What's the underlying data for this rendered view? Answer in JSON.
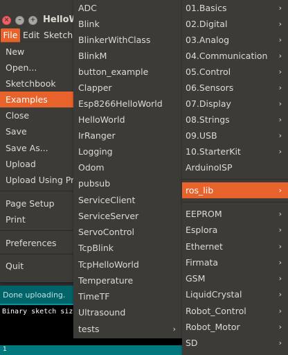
{
  "window": {
    "title": "HelloW",
    "close_glyph": "×",
    "min_glyph": "–",
    "max_glyph": "+"
  },
  "menubar": {
    "file": "File",
    "edit": "Edit",
    "sketch": "Sketch"
  },
  "file_menu": {
    "items": [
      "New",
      "Open...",
      "Sketchbook",
      "Examples",
      "Close",
      "Save",
      "Save As...",
      "Upload",
      "Upload Using Pro",
      "Page Setup",
      "Print",
      "Preferences",
      "Quit"
    ],
    "active": "Examples"
  },
  "examples_menu": {
    "items": [
      "ADC",
      "Blink",
      "BlinkerWithClass",
      "BlinkM",
      "button_example",
      "Clapper",
      "Esp8266HelloWorld",
      "HelloWorld",
      "IrRanger",
      "Logging",
      "Odom",
      "pubsub",
      "ServiceClient",
      "ServiceServer",
      "ServoControl",
      "TcpBlink",
      "TcpHelloWorld",
      "Temperature",
      "TimeTF",
      "Ultrasound",
      "tests"
    ],
    "submenu_arrow": "›"
  },
  "libraries_menu": {
    "items": [
      "01.Basics",
      "02.Digital",
      "03.Analog",
      "04.Communication",
      "05.Control",
      "06.Sensors",
      "07.Display",
      "08.Strings",
      "09.USB",
      "10.StarterKit",
      "ArduinoISP",
      "ros_lib",
      "EEPROM",
      "Esplora",
      "Ethernet",
      "Firmata",
      "GSM",
      "LiquidCrystal",
      "Robot_Control",
      "Robot_Motor",
      "SD"
    ],
    "active": "ros_lib",
    "submenu_arrow": "›"
  },
  "status": {
    "message": "Done uploading."
  },
  "console": {
    "text": "Binary sketch siz"
  },
  "footer": {
    "line": "1"
  },
  "colors": {
    "accent": "#e8622c",
    "menu_bg": "#3c3b37",
    "status_bg": "#006468",
    "footer_bg": "#00787d"
  }
}
